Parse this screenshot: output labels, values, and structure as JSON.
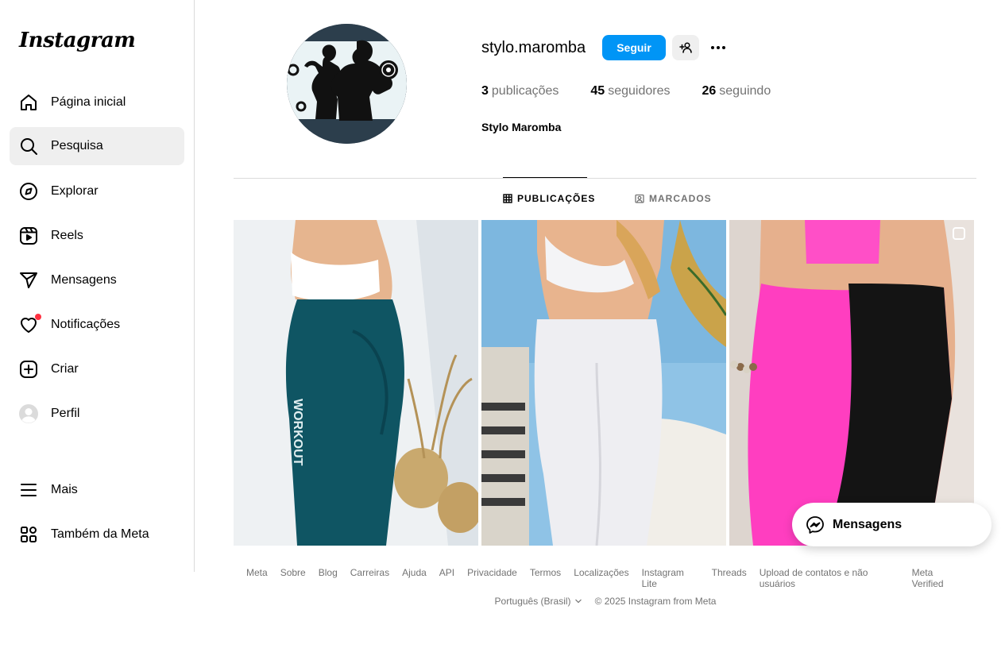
{
  "app": {
    "logo_text": "Instagram"
  },
  "sidebar": {
    "items": [
      {
        "label": "Página inicial",
        "icon": "home-icon"
      },
      {
        "label": "Pesquisa",
        "icon": "search-icon",
        "active": true
      },
      {
        "label": "Explorar",
        "icon": "compass-icon"
      },
      {
        "label": "Reels",
        "icon": "reels-icon"
      },
      {
        "label": "Mensagens",
        "icon": "send-icon"
      },
      {
        "label": "Notificações",
        "icon": "heart-icon"
      },
      {
        "label": "Criar",
        "icon": "plus-square-icon"
      },
      {
        "label": "Perfil",
        "icon": "avatar-icon"
      }
    ],
    "more_label": "Mais",
    "meta_label": "Também da Meta"
  },
  "profile": {
    "username": "stylo.maromba",
    "follow_label": "Seguir",
    "posts_count": "3",
    "posts_label": "publicações",
    "followers_count": "45",
    "followers_label": "seguidores",
    "following_count": "26",
    "following_label": "seguindo",
    "full_name": "Stylo Maromba"
  },
  "tabs": {
    "posts": "PUBLICAÇÕES",
    "tagged": "MARCADOS"
  },
  "messages_float": {
    "label": "Mensagens"
  },
  "footer": {
    "links": [
      "Meta",
      "Sobre",
      "Blog",
      "Carreiras",
      "Ajuda",
      "API",
      "Privacidade",
      "Termos",
      "Localizações",
      "Instagram Lite",
      "Threads",
      "Upload de contatos e não usuários",
      "Meta Verified"
    ],
    "language": "Português (Brasil)",
    "copyright": "© 2025 Instagram from Meta"
  },
  "colors": {
    "primary_button": "#0095f6",
    "notification_dot": "#ff3040",
    "active_nav_bg": "#efefef"
  }
}
